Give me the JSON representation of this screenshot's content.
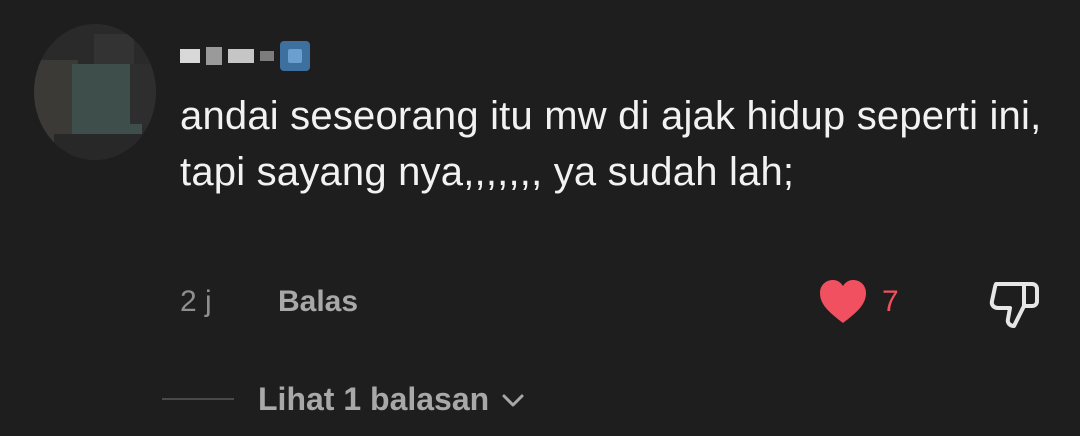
{
  "comment": {
    "username_alt": "username (pixelated)",
    "text": "andai seseorang itu mw di ajak hidup seperti ini, tapi sayang nya,,,,,,, ya sudah lah;",
    "timestamp": "2 j",
    "reply_label": "Balas",
    "like_count": "7",
    "liked": true,
    "view_replies_label": "Lihat 1 balasan"
  },
  "colors": {
    "background": "#1e1e1e",
    "text": "#f2f2f2",
    "muted": "#8f8f8f",
    "like_red": "#f0505f"
  },
  "icons": {
    "like": "heart-filled-icon",
    "dislike": "thumbs-down-icon",
    "expand": "chevron-down-icon",
    "verified": "verified-badge-icon"
  }
}
